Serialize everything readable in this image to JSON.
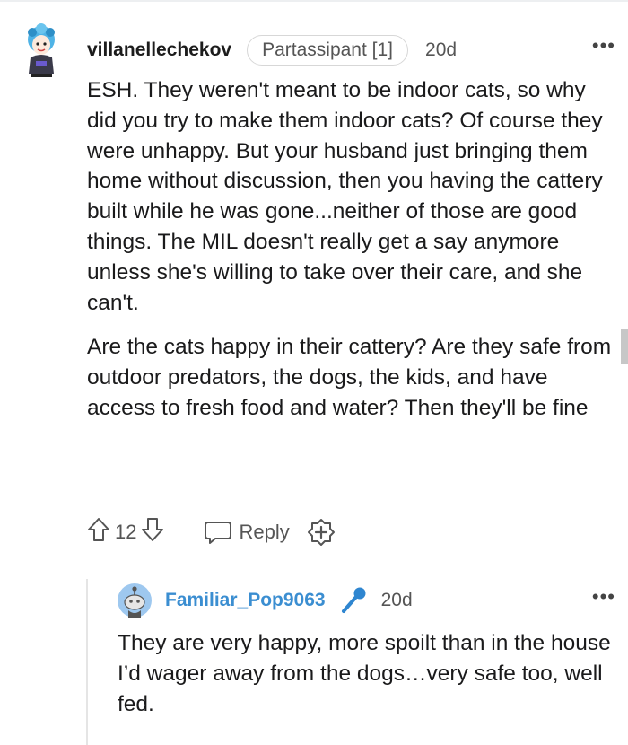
{
  "parent_comment": {
    "username": "villanellechekov",
    "flair": "Partassipant [1]",
    "time": "20d",
    "paragraphs": [
      "ESH. They weren't meant to be indoor cats, so why did you try to make them indoor cats? Of course they were unhappy. But your husband just bringing them home without discussion, then you having the cattery built while he was gone...neither of those are good things. The MIL doesn't really get a say anymore unless she's willing to take over their care, and she can't.",
      "Are the cats happy in their cattery? Are they safe from outdoor predators, the dogs, the kids, and have access to fresh food and water? Then they'll be fine"
    ],
    "vote_count": "12",
    "reply_label": "Reply",
    "more_icon": "•••"
  },
  "reply_comment": {
    "username": "Familiar_Pop9063",
    "time": "20d",
    "text": "They are very happy, more spoilt than in the house I’d wager away from the dogs…very safe too, well fed.",
    "more_icon": "•••"
  },
  "icons": {
    "upvote": "arrow-up-icon",
    "downvote": "arrow-down-icon",
    "reply": "speech-bubble-icon",
    "award": "plus-award-icon",
    "mic": "microphone-icon"
  },
  "colors": {
    "username_reply": "#3b8ed1",
    "avatar_blue": "#37a6d9",
    "mic_blue": "#2f86d0"
  }
}
